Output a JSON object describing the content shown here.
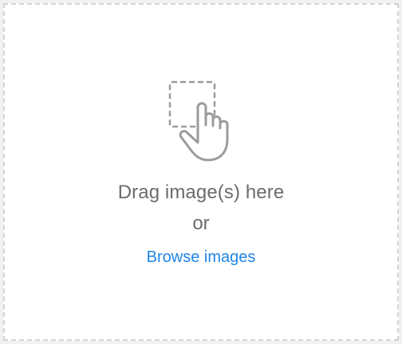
{
  "dropzone": {
    "icon": "drag-hand-icon",
    "drag_text": "Drag image(s) here",
    "or_text": "or",
    "browse_label": "Browse images"
  },
  "colors": {
    "background": "#f1f1f1",
    "panel": "#ffffff",
    "border": "#d2d2d2",
    "text": "#6b6b6b",
    "icon": "#9b9b9b",
    "link": "#1f86e6"
  }
}
